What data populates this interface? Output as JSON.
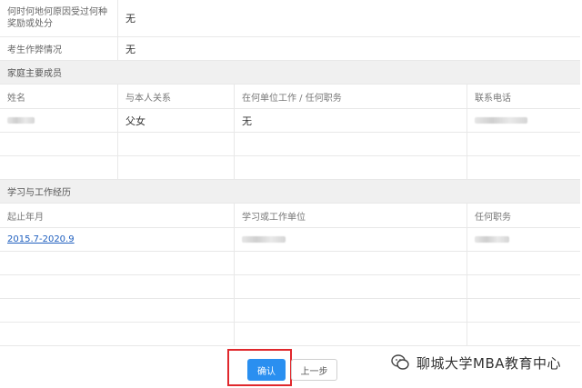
{
  "basic_info": [
    {
      "label": "何时何地何原因受过何种奖励或处分",
      "value": "无"
    },
    {
      "label": "考生作弊情况",
      "value": "无"
    }
  ],
  "family_section": {
    "title": "家庭主要成员",
    "columns": [
      "姓名",
      "与本人关系",
      "在何单位工作 / 任何职务",
      "联系电话"
    ],
    "rows": [
      {
        "name": "",
        "relation": "父女",
        "work": "无",
        "phone": ""
      }
    ]
  },
  "study_section": {
    "title": "学习与工作经历",
    "columns": [
      "起止年月",
      "学习或工作单位",
      "任何职务"
    ],
    "rows": [
      {
        "period": "2015.7-2020.9",
        "unit": "",
        "position": ""
      }
    ]
  },
  "buttons": {
    "confirm": "确认",
    "previous": "上一步"
  },
  "watermark": "聊城大学MBA教育中心",
  "colors": {
    "primary": "#2a8ff0",
    "highlight_border": "#e0282d",
    "link": "#1f5fbf"
  }
}
